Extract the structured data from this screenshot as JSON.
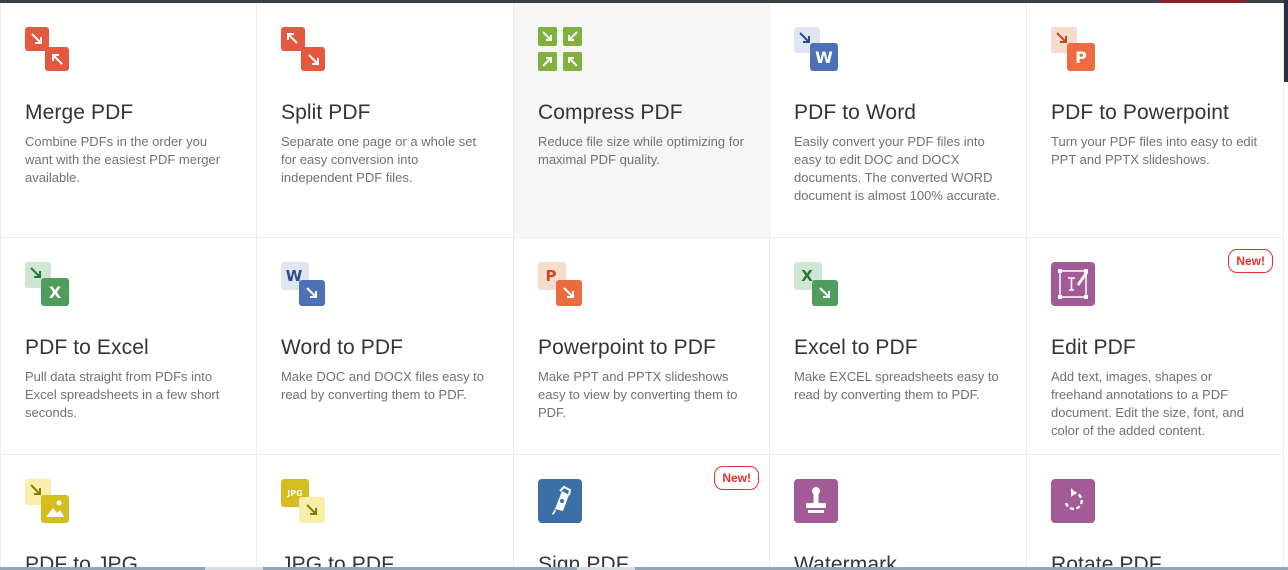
{
  "tools": [
    {
      "title": "Merge PDF",
      "desc": "Combine PDFs in the order you want with the easiest PDF merger available.",
      "icon": "merge-icon"
    },
    {
      "title": "Split PDF",
      "desc": "Separate one page or a whole set for easy conversion into independent PDF files.",
      "icon": "split-icon"
    },
    {
      "title": "Compress PDF",
      "desc": "Reduce file size while optimizing for maximal PDF quality.",
      "icon": "compress-icon"
    },
    {
      "title": "PDF to Word",
      "desc": "Easily convert your PDF files into easy to edit DOC and DOCX documents. The converted WORD document is almost 100% accurate.",
      "icon": "pdf-to-word-icon",
      "letter": "W"
    },
    {
      "title": "PDF to Powerpoint",
      "desc": "Turn your PDF files into easy to edit PPT and PPTX slideshows.",
      "icon": "pdf-to-powerpoint-icon",
      "letter": "P"
    },
    {
      "title": "PDF to Excel",
      "desc": "Pull data straight from PDFs into Excel spreadsheets in a few short seconds.",
      "icon": "pdf-to-excel-icon",
      "letter": "X"
    },
    {
      "title": "Word to PDF",
      "desc": "Make DOC and DOCX files easy to read by converting them to PDF.",
      "icon": "word-to-pdf-icon",
      "letter": "W"
    },
    {
      "title": "Powerpoint to PDF",
      "desc": "Make PPT and PPTX slideshows easy to view by converting them to PDF.",
      "icon": "powerpoint-to-pdf-icon",
      "letter": "P"
    },
    {
      "title": "Excel to PDF",
      "desc": "Make EXCEL spreadsheets easy to read by converting them to PDF.",
      "icon": "excel-to-pdf-icon",
      "letter": "X"
    },
    {
      "title": "Edit PDF",
      "desc": "Add text, images, shapes or freehand annotations to a PDF document. Edit the size, font, and color of the added content.",
      "icon": "edit-pdf-icon",
      "badge": "New!"
    },
    {
      "title": "PDF to JPG",
      "desc": "",
      "icon": "pdf-to-jpg-icon"
    },
    {
      "title": "JPG to PDF",
      "desc": "",
      "icon": "jpg-to-pdf-icon",
      "letter": "JPG"
    },
    {
      "title": "Sign PDF",
      "desc": "",
      "icon": "sign-pdf-icon",
      "badge": "New!"
    },
    {
      "title": "Watermark",
      "desc": "",
      "icon": "watermark-icon"
    },
    {
      "title": "Rotate PDF",
      "desc": "",
      "icon": "rotate-pdf-icon"
    }
  ],
  "colors": {
    "red": "#e5573f",
    "green": "#7fb13c",
    "word": "#4d70b7",
    "powerpoint": "#ec6b3f",
    "excel": "#3b9a4e",
    "edit": "#a25b96",
    "jpg": "#d3bd1f",
    "sign": "#3b6fa6",
    "badge": "#e5322d"
  }
}
